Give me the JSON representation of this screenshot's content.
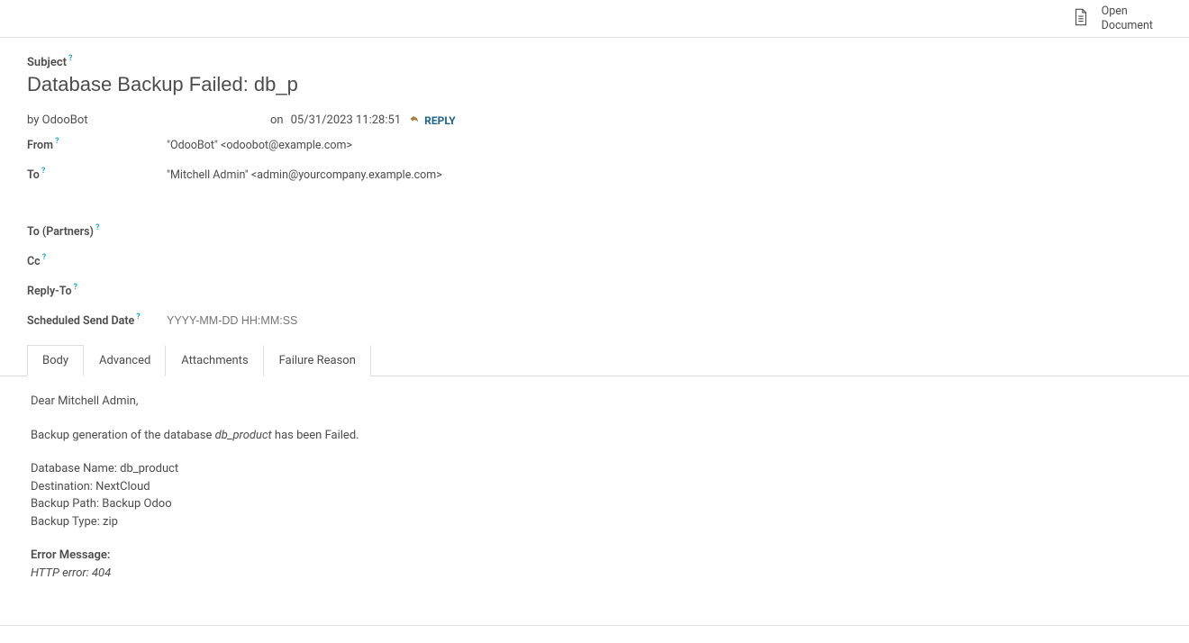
{
  "header": {
    "open_document_label_line1": "Open",
    "open_document_label_line2": "Document"
  },
  "subject_label": "Subject",
  "subject_value": "Database Backup Failed: db_product",
  "by_prefix": "by",
  "author": "OdooBot",
  "on_prefix": "on",
  "date": "05/31/2023 11:28:51",
  "reply_label": "REPLY",
  "fields": {
    "from_label": "From",
    "from_value": "\"OdooBot\" <odoobot@example.com>",
    "to_label": "To",
    "to_value": "\"Mitchell Admin\" <admin@yourcompany.example.com>",
    "to_partners_label": "To (Partners)",
    "cc_label": "Cc",
    "reply_to_label": "Reply-To",
    "scheduled_label": "Scheduled Send Date",
    "scheduled_placeholder": "YYYY-MM-DD HH:MM:SS"
  },
  "tabs": {
    "body": "Body",
    "advanced": "Advanced",
    "attachments": "Attachments",
    "failure": "Failure Reason"
  },
  "body": {
    "greeting": "Dear Mitchell Admin,",
    "line1_pre": "Backup generation of the database ",
    "line1_db": "db_product",
    "line1_post": " has been Failed.",
    "db_name": "Database Name: db_product",
    "dest": "Destination: NextCloud",
    "path": "Backup Path: Backup Odoo",
    "type": "Backup Type: zip",
    "err_head": "Error Message:",
    "err_msg": "HTTP error: 404"
  },
  "help_marker": "?"
}
